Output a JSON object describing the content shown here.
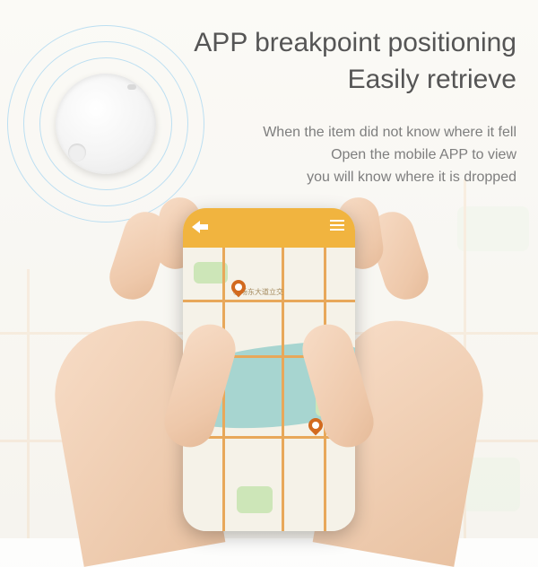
{
  "headline": {
    "line1": "APP breakpoint positioning",
    "line2": "Easily retrieve"
  },
  "subtext": {
    "line1": "When the item did not know where it fell",
    "line2": "Open the mobile APP to view",
    "line3": "you will know where it is dropped"
  },
  "device": {
    "name": "tracker-device"
  },
  "phone": {
    "header_color": "#f1b43f"
  }
}
